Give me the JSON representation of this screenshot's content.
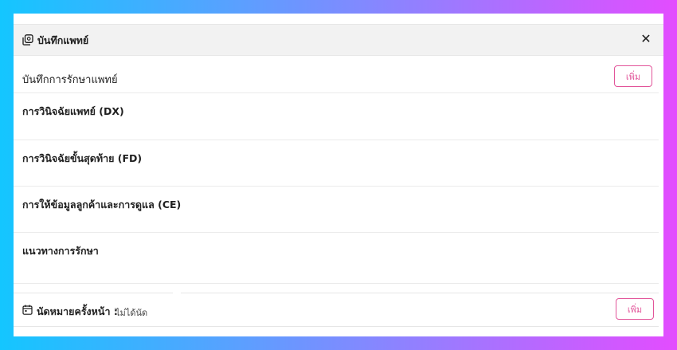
{
  "header": {
    "title": "บันทึกแพทย์",
    "icon": "copy-icon",
    "close_icon": "close-icon",
    "close_label": "✕"
  },
  "record": {
    "title": "บันทึกการรักษาแพทย์",
    "add_label": "เพิ่ม"
  },
  "sections": [
    {
      "title": "การวินิจฉัยแพทย์ (DX)"
    },
    {
      "title": "การวินิจฉัยขั้นสุดท้าย (FD)"
    },
    {
      "title": "การให้ข้อมูลลูกค้าและการดูแล (CE)"
    },
    {
      "title": "แนวทางการรักษา"
    }
  ],
  "appointment": {
    "icon": "calendar-icon",
    "label": "นัดหมายครั้งหน้า :",
    "value": "ไม่ได้นัด",
    "add_label": "เพิ่ม"
  },
  "colors": {
    "accent": "#e2559a",
    "header_bg": "#f2f2f2",
    "gradient_start": "#14c6ff",
    "gradient_end": "#e34cff"
  }
}
